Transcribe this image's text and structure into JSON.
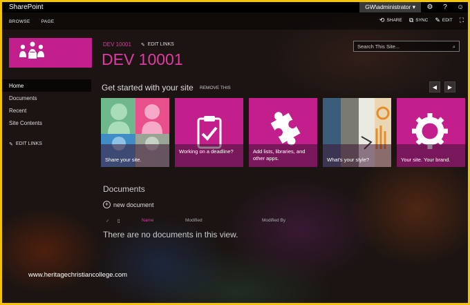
{
  "suitebar": {
    "brand": "SharePoint",
    "user": "GW\\administrator ▾",
    "icons": [
      "gear-icon",
      "help-icon",
      "smiley-icon"
    ]
  },
  "ribbon": {
    "tabs": [
      "BROWSE",
      "PAGE"
    ],
    "share": "SHARE",
    "sync": "SYNC",
    "edit": "EDIT"
  },
  "header": {
    "breadcrumb": "DEV 10001",
    "edit_links": "EDIT LINKS",
    "title": "DEV 10001",
    "search_placeholder": "Search This Site..."
  },
  "leftnav": {
    "items": [
      "Home",
      "Documents",
      "Recent",
      "Site Contents"
    ],
    "active": "Home",
    "edit_links": "EDIT LINKS"
  },
  "get_started": {
    "title": "Get started with your site",
    "remove": "REMOVE THIS",
    "tiles": [
      {
        "caption": "Share your site.",
        "icon": "people-photo-icon"
      },
      {
        "caption": "Working on a deadline?",
        "icon": "clipboard-check-icon"
      },
      {
        "caption": "Add lists, libraries, and other apps.",
        "icon": "puzzle-icon"
      },
      {
        "caption": "What's your style?",
        "icon": "style-photo-icon"
      },
      {
        "caption": "Your site. Your brand.",
        "icon": "gear-brand-icon"
      }
    ]
  },
  "documents": {
    "title": "Documents",
    "new_document": "new document",
    "columns": [
      "Name",
      "Modified",
      "Modified By"
    ],
    "empty_message": "There are no documents in this view."
  },
  "watermark": "www.heritagechristiancollege.com",
  "colors": {
    "accent": "#c21e8c",
    "frame": "#f5c400"
  }
}
